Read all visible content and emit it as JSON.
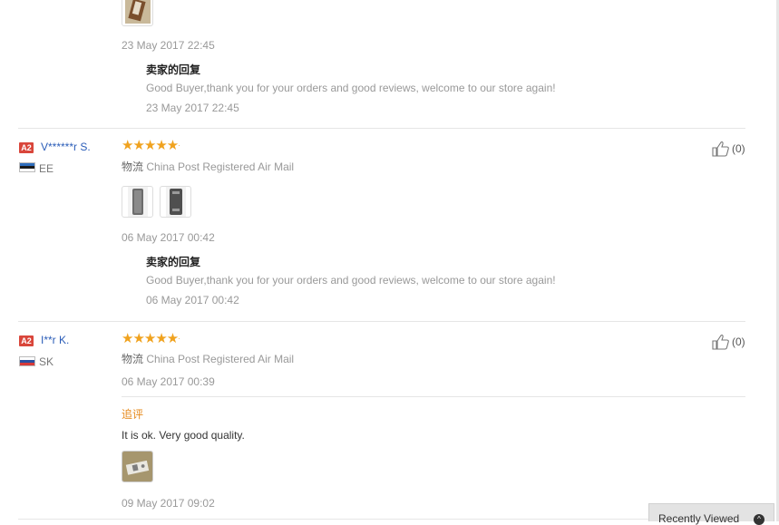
{
  "reviews": [
    {
      "date": "23 May 2017 22:45",
      "reply": {
        "title": "卖家的回复",
        "text": "Good Buyer,thank you for your orders and good reviews, welcome to our store again!",
        "date": "23 May 2017 22:45"
      }
    },
    {
      "badge": "A2",
      "user": "V******r S.",
      "country": "EE",
      "rating": 5,
      "stars": "★★★★★",
      "shipping_label": "物流",
      "shipping": "China Post Registered Air Mail",
      "likes": "(0)",
      "date": "06 May 2017 00:42",
      "reply": {
        "title": "卖家的回复",
        "text": "Good Buyer,thank you for your orders and good reviews, welcome to our store again!",
        "date": "06 May 2017 00:42"
      }
    },
    {
      "badge": "A2",
      "user": "I**r K.",
      "country": "SK",
      "rating": 5,
      "stars": "★★★★★",
      "shipping_label": "物流",
      "shipping": "China Post Registered Air Mail",
      "likes": "(0)",
      "date": "06 May 2017 00:39",
      "additional": {
        "label": "追评",
        "text": "It is ok. Very good quality.",
        "date": "09 May 2017 09:02"
      }
    }
  ],
  "recently_viewed": {
    "label": "Recently Viewed",
    "icon": "chevron-up-icon"
  },
  "colors": {
    "star": "#f0a21e",
    "username": "#2b5db8",
    "badge": "#d9463b",
    "additional_label": "#e6891b"
  }
}
